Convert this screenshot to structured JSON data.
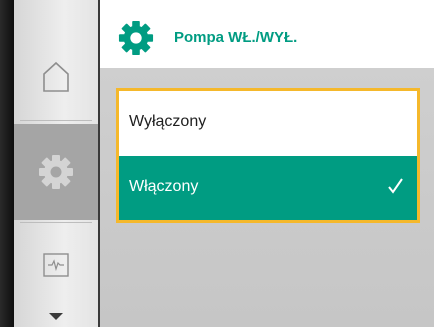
{
  "header": {
    "title": "Pompa WŁ./WYŁ.",
    "icon": "gear-icon"
  },
  "sidebar": {
    "items": [
      {
        "icon": "home-icon",
        "selected": false
      },
      {
        "icon": "settings-gear-icon",
        "selected": true
      },
      {
        "icon": "monitor-icon",
        "selected": false
      },
      {
        "icon": "scroll-down-arrow-icon",
        "selected": false
      }
    ]
  },
  "menu": {
    "items": [
      {
        "label": "Wyłączony",
        "selected": false
      },
      {
        "label": "Włączony",
        "selected": true
      }
    ]
  },
  "colors": {
    "accent": "#009c82",
    "focus_border": "#f5b82b",
    "content_bg": "#c8c8c8",
    "sidebar_selected": "#a5a5a5"
  }
}
